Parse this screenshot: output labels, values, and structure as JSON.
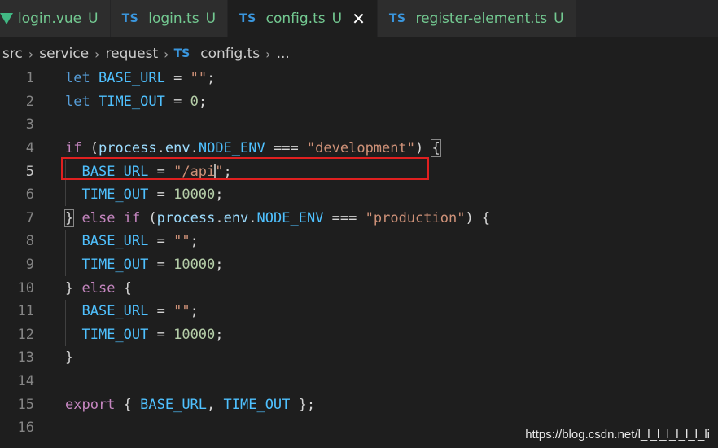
{
  "tabs": [
    {
      "name": "login.vue",
      "badge": "U",
      "icon": "vue-icon"
    },
    {
      "name": "login.ts",
      "badge": "U",
      "icon": "ts-icon",
      "icon_text": "TS"
    },
    {
      "name": "config.ts",
      "badge": "U",
      "icon": "ts-icon",
      "icon_text": "TS",
      "close": "✕"
    },
    {
      "name": "register-element.ts",
      "badge": "U",
      "icon": "ts-icon",
      "icon_text": "TS"
    }
  ],
  "breadcrumb": {
    "items": [
      "src",
      "service",
      "request",
      "config.ts",
      "..."
    ],
    "ts_icon_text": "TS",
    "separator": "›"
  },
  "editor": {
    "line_numbers": [
      "1",
      "2",
      "3",
      "4",
      "5",
      "6",
      "7",
      "8",
      "9",
      "10",
      "11",
      "12",
      "13",
      "14",
      "15",
      "16"
    ],
    "current_line": "5"
  },
  "watermark": "https://blog.csdn.net/l_l_l_l_l_l_l_li",
  "colors": {
    "keyword": "#569cd6",
    "control": "#c586c0",
    "variable": "#9cdcfe",
    "constant": "#4fc1ff",
    "string": "#ce9178",
    "number": "#b5cea8",
    "highlight_box": "#e02020"
  }
}
